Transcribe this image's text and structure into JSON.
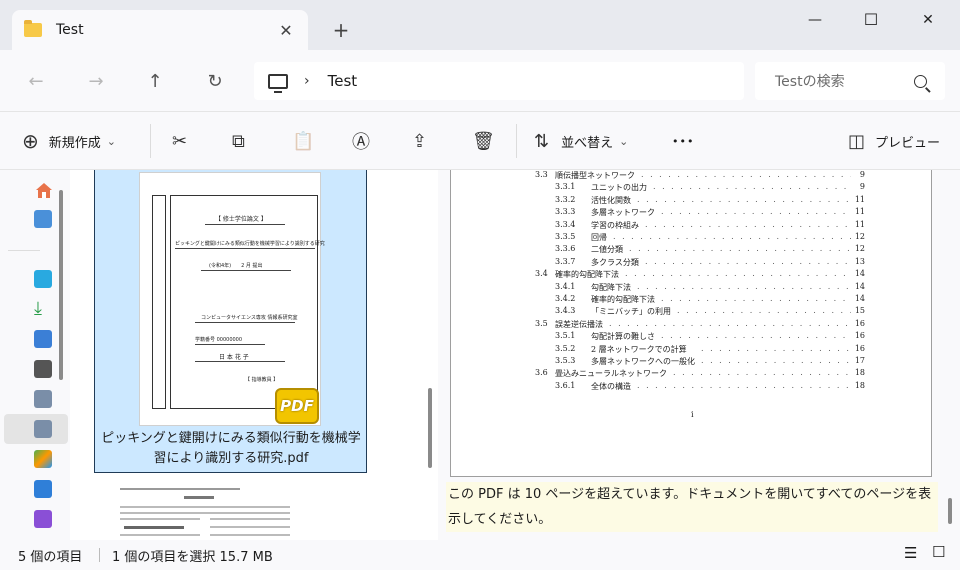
{
  "tab": {
    "title": "Test",
    "close_glyph": "✕",
    "new_glyph": "+"
  },
  "window": {
    "minimize": "—",
    "maximize": "☐",
    "close": "✕"
  },
  "nav": {
    "back": "←",
    "forward": "→",
    "up": "↑",
    "refresh": "↻",
    "chevron": "›"
  },
  "address": {
    "crumb": "Test"
  },
  "search": {
    "placeholder": "Testの検索"
  },
  "toolbar": {
    "new_label": "新規作成",
    "new_chevron": "⌄",
    "sort_label": "並べ替え",
    "sort_chevron": "⌄",
    "more": "•••",
    "preview_label": "プレビュー",
    "glyphs": {
      "new": "⊕",
      "cut": "✂",
      "copy": "⧉",
      "paste": "📋",
      "rename": "Ⓐ",
      "share": "⇪",
      "delete": "🗑",
      "sort": "⇅",
      "preview": "◫"
    }
  },
  "files": {
    "selected_name": "ピッキングと鍵開けにみる類似行動を機械学習により識別する研究.pdf",
    "thumb": {
      "heading": "【 修士学位論文 】",
      "subtitle": "ピッキングと鍵開けにみる類似行動を機械学習により識別する研究",
      "date": "(令和4年)　　2 月 提出",
      "dept": "コンピュータサイエンス専攻 情報系研究室",
      "student_id": "学籍番号 00000000",
      "name": "日 本 花 子",
      "supervisor": "【 指導教員 】",
      "badge": "PDF"
    }
  },
  "preview": {
    "toc": [
      {
        "num": "3.3",
        "title": "順伝播型ネットワーク",
        "page": "9",
        "level": 1
      },
      {
        "num": "3.3.1",
        "title": "ユニットの出力",
        "page": "9",
        "level": 2
      },
      {
        "num": "3.3.2",
        "title": "活性化関数",
        "page": "11",
        "level": 2
      },
      {
        "num": "3.3.3",
        "title": "多層ネットワーク",
        "page": "11",
        "level": 2
      },
      {
        "num": "3.3.4",
        "title": "学習の枠組み",
        "page": "11",
        "level": 2
      },
      {
        "num": "3.3.5",
        "title": "回帰",
        "page": "12",
        "level": 2
      },
      {
        "num": "3.3.6",
        "title": "二値分類",
        "page": "12",
        "level": 2
      },
      {
        "num": "3.3.7",
        "title": "多クラス分類",
        "page": "13",
        "level": 2
      },
      {
        "num": "3.4",
        "title": "確率的勾配降下法",
        "page": "14",
        "level": 1
      },
      {
        "num": "3.4.1",
        "title": "勾配降下法",
        "page": "14",
        "level": 2
      },
      {
        "num": "3.4.2",
        "title": "確率的勾配降下法",
        "page": "14",
        "level": 2
      },
      {
        "num": "3.4.3",
        "title": "「ミニバッチ」の利用",
        "page": "15",
        "level": 2
      },
      {
        "num": "3.5",
        "title": "誤差逆伝播法",
        "page": "16",
        "level": 1
      },
      {
        "num": "3.5.1",
        "title": "勾配計算の難しさ",
        "page": "16",
        "level": 2
      },
      {
        "num": "3.5.2",
        "title": "2 層ネットワークでの計算",
        "page": "16",
        "level": 2
      },
      {
        "num": "3.5.3",
        "title": "多層ネットワークへの一般化",
        "page": "17",
        "level": 2
      },
      {
        "num": "3.6",
        "title": "畳込みニューラルネットワーク",
        "page": "18",
        "level": 1
      },
      {
        "num": "3.6.1",
        "title": "全体の構造",
        "page": "18",
        "level": 2
      }
    ],
    "page_number": "i",
    "notice": "この PDF は 10 ページを超えています。ドキュメントを開いてすべてのページを表示してください。"
  },
  "status": {
    "item_count": "5 個の項目",
    "selection": "1 個の項目を選択  15.7 MB",
    "details_view_glyph": "☰",
    "tiles_view_glyph": "☐"
  },
  "colors": {
    "selection": "#cce8ff",
    "notice": "#fdfbe4",
    "accent": "#0067c0"
  }
}
